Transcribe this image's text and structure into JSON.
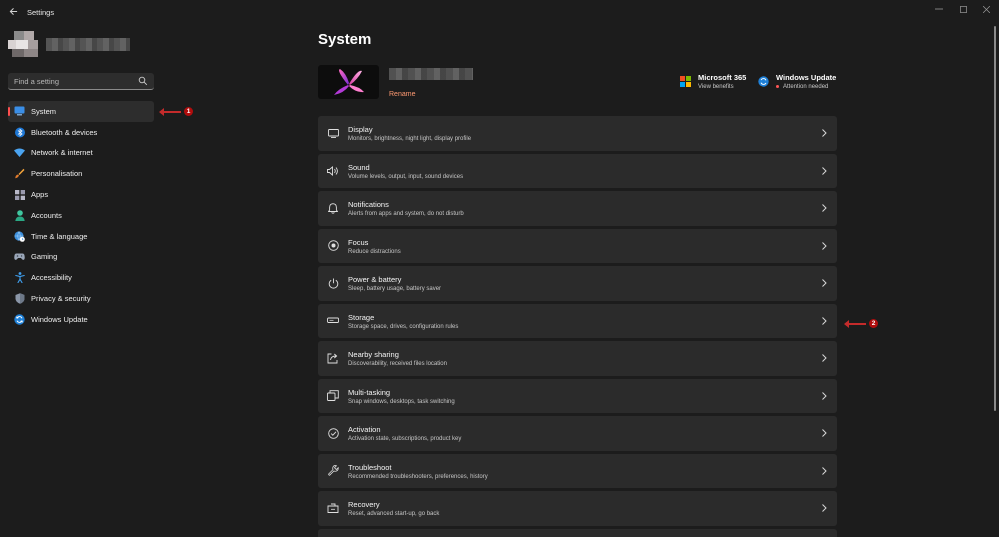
{
  "window": {
    "title": "Settings"
  },
  "search": {
    "placeholder": "Find a setting"
  },
  "sidebar": {
    "items": [
      {
        "label": "System",
        "icon": "monitor-icon",
        "active": true
      },
      {
        "label": "Bluetooth & devices",
        "icon": "bluetooth-icon"
      },
      {
        "label": "Network & internet",
        "icon": "wifi-icon"
      },
      {
        "label": "Personalisation",
        "icon": "brush-icon"
      },
      {
        "label": "Apps",
        "icon": "apps-icon"
      },
      {
        "label": "Accounts",
        "icon": "person-icon"
      },
      {
        "label": "Time & language",
        "icon": "globe-clock-icon"
      },
      {
        "label": "Gaming",
        "icon": "gamepad-icon"
      },
      {
        "label": "Accessibility",
        "icon": "accessibility-icon"
      },
      {
        "label": "Privacy & security",
        "icon": "shield-icon"
      },
      {
        "label": "Windows Update",
        "icon": "update-icon"
      }
    ]
  },
  "annotations": {
    "first": "1",
    "second": "2"
  },
  "main": {
    "title": "System",
    "device": {
      "rename_label": "Rename"
    },
    "quick": {
      "m365": {
        "title": "Microsoft 365",
        "sub": "View benefits"
      },
      "update": {
        "title": "Windows Update",
        "sub": "Attention needed"
      }
    },
    "rows": [
      {
        "title": "Display",
        "sub": "Monitors, brightness, night light, display profile",
        "icon": "display-icon"
      },
      {
        "title": "Sound",
        "sub": "Volume levels, output, input, sound devices",
        "icon": "speaker-icon"
      },
      {
        "title": "Notifications",
        "sub": "Alerts from apps and system, do not disturb",
        "icon": "bell-icon"
      },
      {
        "title": "Focus",
        "sub": "Reduce distractions",
        "icon": "focus-icon"
      },
      {
        "title": "Power & battery",
        "sub": "Sleep, battery usage, battery saver",
        "icon": "power-icon"
      },
      {
        "title": "Storage",
        "sub": "Storage space, drives, configuration rules",
        "icon": "storage-icon"
      },
      {
        "title": "Nearby sharing",
        "sub": "Discoverability, received files location",
        "icon": "share-icon"
      },
      {
        "title": "Multi-tasking",
        "sub": "Snap windows, desktops, task switching",
        "icon": "multitask-icon"
      },
      {
        "title": "Activation",
        "sub": "Activation state, subscriptions, product key",
        "icon": "check-circle-icon"
      },
      {
        "title": "Troubleshoot",
        "sub": "Recommended troubleshooters, preferences, history",
        "icon": "wrench-icon"
      },
      {
        "title": "Recovery",
        "sub": "Reset, advanced start-up, go back",
        "icon": "recovery-icon"
      }
    ]
  },
  "colors": {
    "accent": "#ff4f4f",
    "link": "#ff9a72",
    "annotation": "#c42b2b"
  }
}
